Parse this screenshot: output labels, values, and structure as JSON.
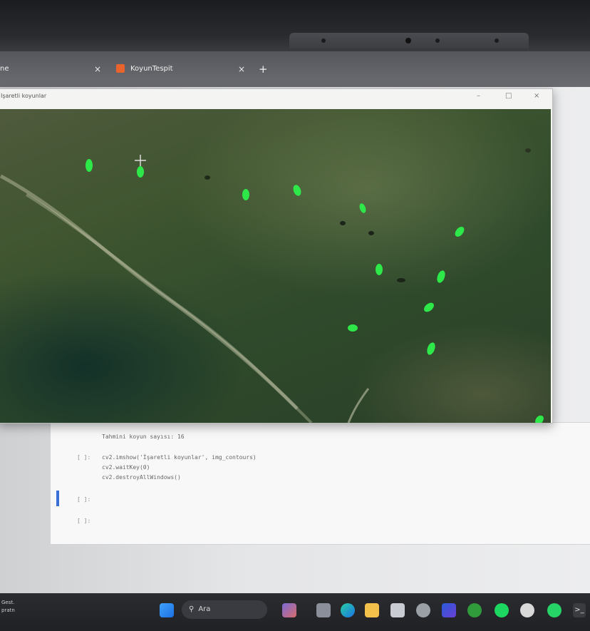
{
  "browser": {
    "tabs": [
      {
        "label": "ne",
        "active": false
      },
      {
        "label": "KoyunTespit",
        "active": true
      }
    ],
    "new_tab_symbol": "+",
    "close_symbol": "×"
  },
  "cv_window": {
    "title": "Işaretli koyunlar",
    "controls": {
      "minimize": "–",
      "maximize": "□",
      "close": "×"
    },
    "colors": {
      "marker": "#2ee84a",
      "field_dark": "#2a3f28",
      "field_light": "#5b6a45"
    }
  },
  "notebook": {
    "output_text": "Tahmini koyun sayısı: 16",
    "cells": [
      {
        "prompt": "[ ]:",
        "lines": [
          "cv2.imshow('İşaretli koyunlar', img_contours)",
          "cv2.waitKey(0)",
          "cv2.destroyAllWindows()"
        ]
      },
      {
        "prompt": "[ ]:",
        "lines": []
      },
      {
        "prompt": "[ ]:",
        "lines": []
      }
    ]
  },
  "taskbar": {
    "left_text": [
      "Gest.",
      "pratn"
    ],
    "search_placeholder": "Ara",
    "icons": [
      "windows-start-icon",
      "search-icon",
      "widgets-icon",
      "file-explorer-icon",
      "edge-icon",
      "folder-icon",
      "calendar-icon",
      "settings-icon",
      "pycharm-icon",
      "xbox-icon",
      "spotify-icon",
      "gear-icon",
      "whatsapp-icon",
      "terminal-icon"
    ]
  }
}
